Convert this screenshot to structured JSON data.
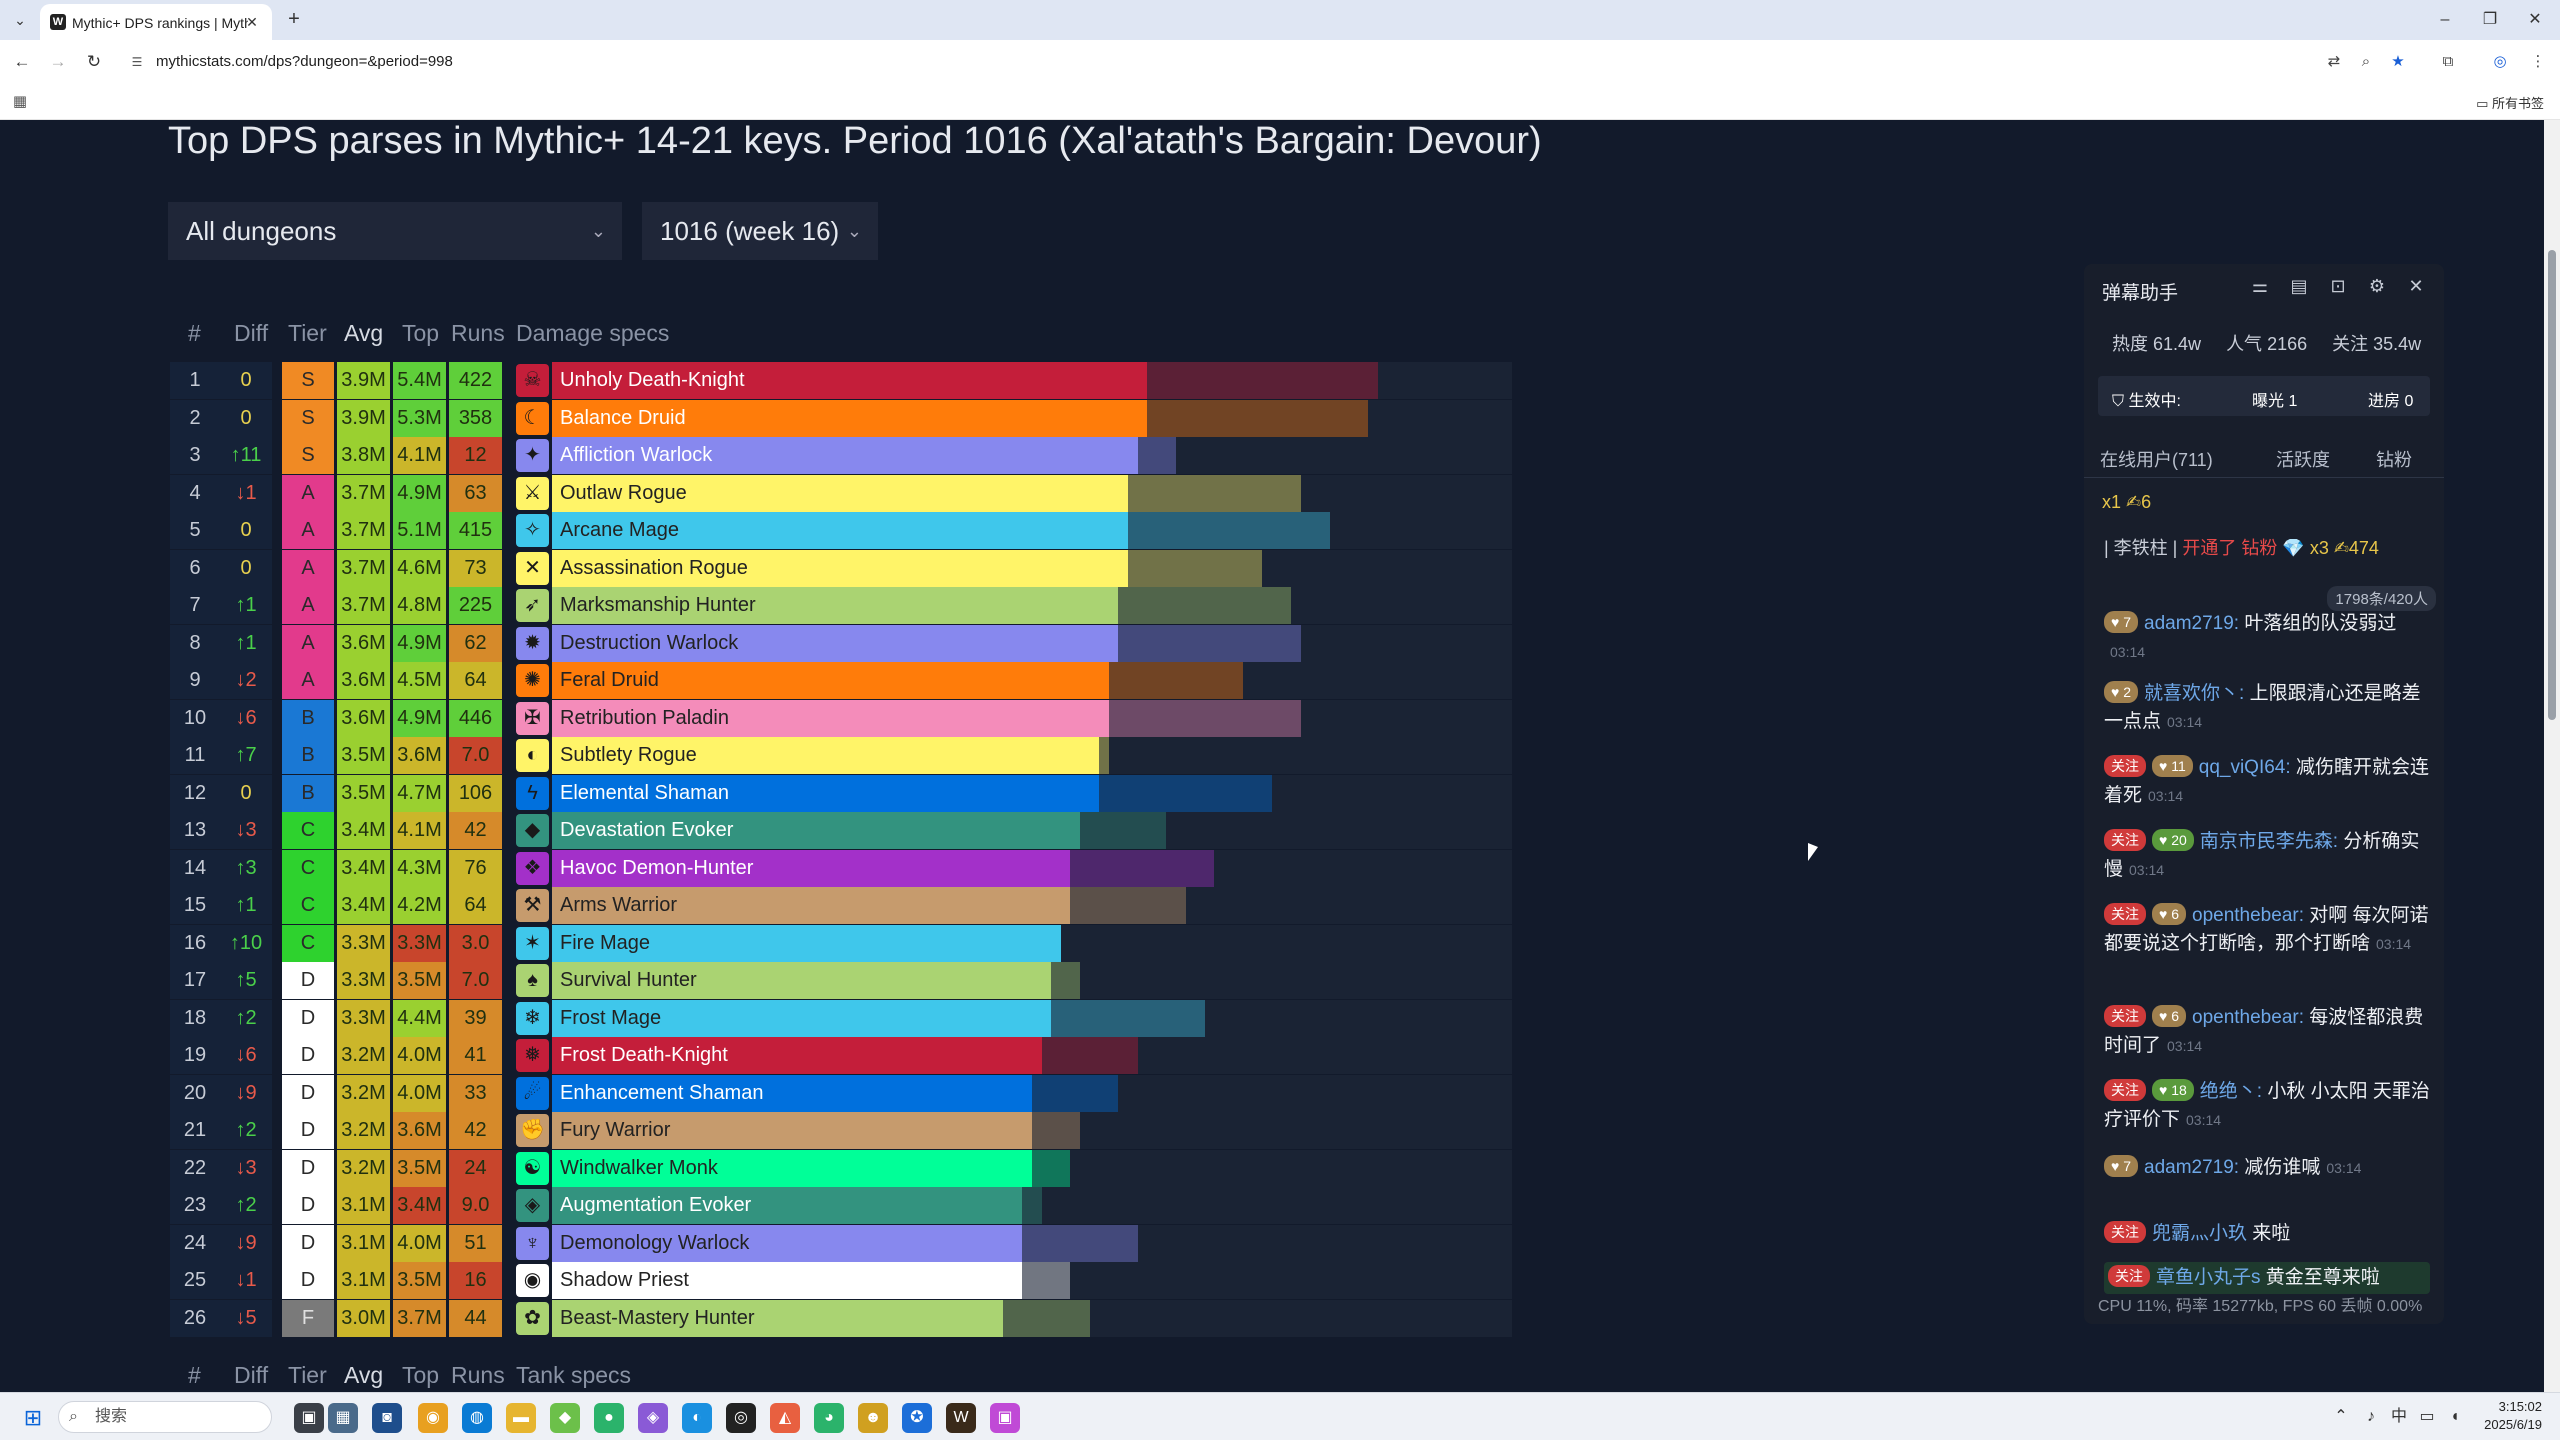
{
  "browser": {
    "tab_title": "Mythic+ DPS rankings | Myth",
    "tab_favicon": "W",
    "url": "mythicstats.com/dps?dungeon=&period=998",
    "all_bookmarks": "所有书签"
  },
  "page": {
    "title": "Top DPS parses in Mythic+ 14-21 keys. Period 1016 (Xal'atath's Bargain: Devour)",
    "dungeon_select": "All dungeons",
    "period_select": "1016 (week 16)",
    "headers": {
      "rank": "#",
      "diff": "Diff",
      "tier": "Tier",
      "avg": "Avg",
      "top": "Top",
      "runs": "Runs",
      "specs": "Damage specs",
      "tank_specs": "Tank specs"
    },
    "rows": [
      {
        "rank": "1",
        "diff": "0",
        "tier": "S",
        "avg": "3.9M",
        "top": "5.4M",
        "runs": "422",
        "spec": "Unholy Death-Knight",
        "color": "#C41E3A",
        "text": "#ffffff",
        "avg_frac": 0.62,
        "top_frac": 0.86,
        "icon": "☠"
      },
      {
        "rank": "2",
        "diff": "0",
        "tier": "S",
        "avg": "3.9M",
        "top": "5.3M",
        "runs": "358",
        "spec": "Balance Druid",
        "color": "#FF7C0A",
        "text": "#ffffff",
        "avg_frac": 0.62,
        "top_frac": 0.85,
        "icon": "☾"
      },
      {
        "rank": "3",
        "diff": "↑11",
        "tier": "S",
        "avg": "3.8M",
        "top": "4.1M",
        "runs": "12",
        "spec": "Affliction Warlock",
        "color": "#8788EE",
        "text": "#ffffff",
        "avg_frac": 0.61,
        "top_frac": 0.65,
        "icon": "✦"
      },
      {
        "rank": "4",
        "diff": "↓1",
        "tier": "A",
        "avg": "3.7M",
        "top": "4.9M",
        "runs": "63",
        "spec": "Outlaw Rogue",
        "color": "#FFF468",
        "text": "#222222",
        "avg_frac": 0.6,
        "top_frac": 0.78,
        "icon": "⚔"
      },
      {
        "rank": "5",
        "diff": "0",
        "tier": "A",
        "avg": "3.7M",
        "top": "5.1M",
        "runs": "415",
        "spec": "Arcane Mage",
        "color": "#3FC7EB",
        "text": "#222222",
        "avg_frac": 0.6,
        "top_frac": 0.81,
        "icon": "✧"
      },
      {
        "rank": "6",
        "diff": "0",
        "tier": "A",
        "avg": "3.7M",
        "top": "4.6M",
        "runs": "73",
        "spec": "Assassination Rogue",
        "color": "#FFF468",
        "text": "#222222",
        "avg_frac": 0.6,
        "top_frac": 0.74,
        "icon": "✕"
      },
      {
        "rank": "7",
        "diff": "↑1",
        "tier": "A",
        "avg": "3.7M",
        "top": "4.8M",
        "runs": "225",
        "spec": "Marksmanship Hunter",
        "color": "#AAD372",
        "text": "#222222",
        "avg_frac": 0.59,
        "top_frac": 0.77,
        "icon": "➶"
      },
      {
        "rank": "8",
        "diff": "↑1",
        "tier": "A",
        "avg": "3.6M",
        "top": "4.9M",
        "runs": "62",
        "spec": "Destruction Warlock",
        "color": "#8788EE",
        "text": "#222222",
        "avg_frac": 0.59,
        "top_frac": 0.78,
        "icon": "✹"
      },
      {
        "rank": "9",
        "diff": "↓2",
        "tier": "A",
        "avg": "3.6M",
        "top": "4.5M",
        "runs": "64",
        "spec": "Feral Druid",
        "color": "#FF7C0A",
        "text": "#222222",
        "avg_frac": 0.58,
        "top_frac": 0.72,
        "icon": "✺"
      },
      {
        "rank": "10",
        "diff": "↓6",
        "tier": "B",
        "avg": "3.6M",
        "top": "4.9M",
        "runs": "446",
        "spec": "Retribution Paladin",
        "color": "#F48CBA",
        "text": "#222222",
        "avg_frac": 0.58,
        "top_frac": 0.78,
        "icon": "✠"
      },
      {
        "rank": "11",
        "diff": "↑7",
        "tier": "B",
        "avg": "3.5M",
        "top": "3.6M",
        "runs": "7.0",
        "spec": "Subtlety Rogue",
        "color": "#FFF468",
        "text": "#222222",
        "avg_frac": 0.57,
        "top_frac": 0.58,
        "icon": "◐"
      },
      {
        "rank": "12",
        "diff": "0",
        "tier": "B",
        "avg": "3.5M",
        "top": "4.7M",
        "runs": "106",
        "spec": "Elemental Shaman",
        "color": "#0070DD",
        "text": "#ffffff",
        "avg_frac": 0.57,
        "top_frac": 0.75,
        "icon": "ϟ"
      },
      {
        "rank": "13",
        "diff": "↓3",
        "tier": "C",
        "avg": "3.4M",
        "top": "4.1M",
        "runs": "42",
        "spec": "Devastation Evoker",
        "color": "#33937F",
        "text": "#ffffff",
        "avg_frac": 0.55,
        "top_frac": 0.64,
        "icon": "◆"
      },
      {
        "rank": "14",
        "diff": "↑3",
        "tier": "C",
        "avg": "3.4M",
        "top": "4.3M",
        "runs": "76",
        "spec": "Havoc Demon-Hunter",
        "color": "#A330C9",
        "text": "#ffffff",
        "avg_frac": 0.54,
        "top_frac": 0.69,
        "icon": "❖"
      },
      {
        "rank": "15",
        "diff": "↑1",
        "tier": "C",
        "avg": "3.4M",
        "top": "4.2M",
        "runs": "64",
        "spec": "Arms Warrior",
        "color": "#C69B6D",
        "text": "#222222",
        "avg_frac": 0.54,
        "top_frac": 0.66,
        "icon": "⚒"
      },
      {
        "rank": "16",
        "diff": "↑10",
        "tier": "C",
        "avg": "3.3M",
        "top": "3.3M",
        "runs": "3.0",
        "spec": "Fire Mage",
        "color": "#3FC7EB",
        "text": "#222222",
        "avg_frac": 0.53,
        "top_frac": 0.53,
        "icon": "✶"
      },
      {
        "rank": "17",
        "diff": "↑5",
        "tier": "D",
        "avg": "3.3M",
        "top": "3.5M",
        "runs": "7.0",
        "spec": "Survival Hunter",
        "color": "#AAD372",
        "text": "#222222",
        "avg_frac": 0.52,
        "top_frac": 0.55,
        "icon": "♠"
      },
      {
        "rank": "18",
        "diff": "↑2",
        "tier": "D",
        "avg": "3.3M",
        "top": "4.4M",
        "runs": "39",
        "spec": "Frost Mage",
        "color": "#3FC7EB",
        "text": "#222222",
        "avg_frac": 0.52,
        "top_frac": 0.68,
        "icon": "❄"
      },
      {
        "rank": "19",
        "diff": "↓6",
        "tier": "D",
        "avg": "3.2M",
        "top": "4.0M",
        "runs": "41",
        "spec": "Frost Death-Knight",
        "color": "#C41E3A",
        "text": "#ffffff",
        "avg_frac": 0.51,
        "top_frac": 0.61,
        "icon": "❅"
      },
      {
        "rank": "20",
        "diff": "↓9",
        "tier": "D",
        "avg": "3.2M",
        "top": "4.0M",
        "runs": "33",
        "spec": "Enhancement Shaman",
        "color": "#0070DD",
        "text": "#ffffff",
        "avg_frac": 0.5,
        "top_frac": 0.59,
        "icon": "☄"
      },
      {
        "rank": "21",
        "diff": "↑2",
        "tier": "D",
        "avg": "3.2M",
        "top": "3.6M",
        "runs": "42",
        "spec": "Fury Warrior",
        "color": "#C69B6D",
        "text": "#222222",
        "avg_frac": 0.5,
        "top_frac": 0.55,
        "icon": "✊"
      },
      {
        "rank": "22",
        "diff": "↓3",
        "tier": "D",
        "avg": "3.2M",
        "top": "3.5M",
        "runs": "24",
        "spec": "Windwalker Monk",
        "color": "#00FF98",
        "text": "#222222",
        "avg_frac": 0.5,
        "top_frac": 0.54,
        "icon": "☯"
      },
      {
        "rank": "23",
        "diff": "↑2",
        "tier": "D",
        "avg": "3.1M",
        "top": "3.4M",
        "runs": "9.0",
        "spec": "Augmentation Evoker",
        "color": "#33937F",
        "text": "#ffffff",
        "avg_frac": 0.49,
        "top_frac": 0.51,
        "icon": "◈"
      },
      {
        "rank": "24",
        "diff": "↓9",
        "tier": "D",
        "avg": "3.1M",
        "top": "4.0M",
        "runs": "51",
        "spec": "Demonology Warlock",
        "color": "#8788EE",
        "text": "#222222",
        "avg_frac": 0.49,
        "top_frac": 0.61,
        "icon": "♆"
      },
      {
        "rank": "25",
        "diff": "↓1",
        "tier": "D",
        "avg": "3.1M",
        "top": "3.5M",
        "runs": "16",
        "spec": "Shadow Priest",
        "color": "#FFFFFF",
        "text": "#222222",
        "avg_frac": 0.49,
        "top_frac": 0.54,
        "icon": "◉"
      },
      {
        "rank": "26",
        "diff": "↓5",
        "tier": "F",
        "avg": "3.0M",
        "top": "3.7M",
        "runs": "44",
        "spec": "Beast-Mastery Hunter",
        "color": "#AAD372",
        "text": "#222222",
        "avg_frac": 0.47,
        "top_frac": 0.56,
        "icon": "✿"
      }
    ],
    "tier_colors": {
      "S": "#f08a24",
      "A": "#e23a8c",
      "B": "#1a78d4",
      "C": "#2ed22e",
      "D": "#ffffff",
      "F": "#7a7a7a"
    }
  },
  "overlay": {
    "title": "弹幕助手",
    "heat": "热度 61.4w",
    "popularity": "人气 2166",
    "follow": "关注 35.4w",
    "status_label": "生效中:",
    "exposure": "曝光 1",
    "entry": "进房 0",
    "tab_online": "在线用户(711)",
    "tab_activity": "活跃度",
    "tab_diamond": "钻粉",
    "combo": "x1 ✍6",
    "notice_user": "| 李铁柱 |",
    "notice_action": "开通了 钻粉",
    "notice_gift": "💎 x3 ✍474",
    "count": "1798条/420人",
    "messages": [
      {
        "badge": "7",
        "badge_type": "lvl",
        "name": "adam2719:",
        "text": "叶落组的队没弱过",
        "time": "03:14"
      },
      {
        "badge": "2",
        "badge_type": "lvl",
        "name": "就喜欢你丶:",
        "text": "上限跟清心还是略差一点点",
        "time": "03:14"
      },
      {
        "badge": "11",
        "badge_type": "fol",
        "name": "qq_viQI64:",
        "text": "减伤瞎开就会连着死",
        "time": "03:14"
      },
      {
        "badge": "20",
        "badge_type": "fol",
        "name": "南京市民李先森:",
        "text": "分析确实慢",
        "time": "03:14"
      },
      {
        "badge": "6",
        "badge_type": "fol",
        "name": "openthebear:",
        "text": "对啊 每次阿诺都要说这个打断啥，那个打断啥",
        "time": "03:14"
      },
      {
        "badge": "6",
        "badge_type": "fol",
        "name": "openthebear:",
        "text": "每波怪都浪费时间了",
        "time": "03:14"
      },
      {
        "badge": "18",
        "badge_type": "fol",
        "name": "绝绝丶:",
        "text": "小秋 小太阳 天罪治疗评价下",
        "time": "03:14"
      },
      {
        "badge": "7",
        "badge_type": "lvl",
        "name": "adam2719:",
        "text": "减伤谁喊",
        "time": "03:14"
      },
      {
        "badge": "",
        "badge_type": "fol",
        "name": "兜霸灬小玖",
        "text": "来啦",
        "time": ""
      },
      {
        "badge": "",
        "badge_type": "fol",
        "name": "章鱼小丸子s",
        "text": "黄金至尊来啦",
        "time": ""
      }
    ],
    "follow_label": "关注",
    "footer": "CPU 11%, 码率 15277kb, FPS 60  丢帧 0.00%"
  },
  "taskbar": {
    "search": "搜索",
    "ime": "中",
    "time": "3:15:02",
    "date": "2025/6/19"
  }
}
